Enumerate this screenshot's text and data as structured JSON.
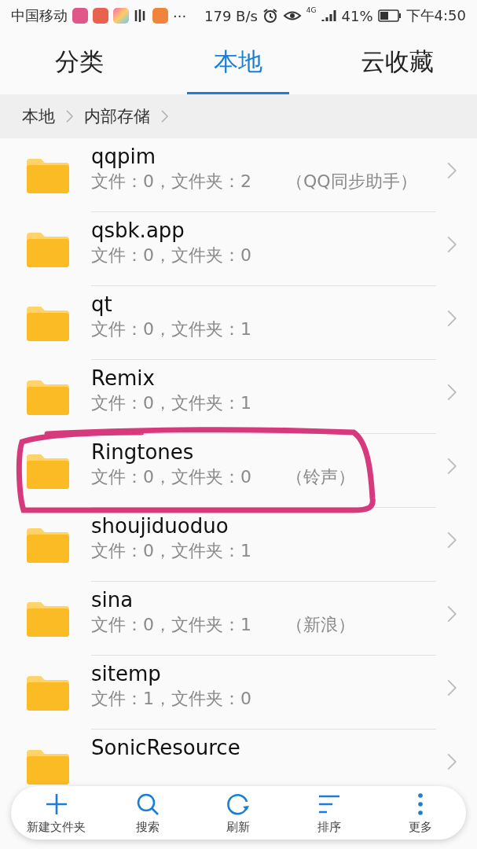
{
  "status_bar": {
    "carrier": "中国移动",
    "more": "···",
    "speed": "179 B/s",
    "network_type": "4G",
    "battery": "41%",
    "time": "下午4:50"
  },
  "tabs": [
    {
      "label": "分类",
      "selected": false
    },
    {
      "label": "本地",
      "selected": true
    },
    {
      "label": "云收藏",
      "selected": false
    }
  ],
  "breadcrumb": [
    "本地",
    "内部存储"
  ],
  "folders": [
    {
      "name": "qqpim",
      "info": "文件：0，文件夹：2",
      "note": "（QQ同步助手）"
    },
    {
      "name": "qsbk.app",
      "info": "文件：0，文件夹：0"
    },
    {
      "name": "qt",
      "info": "文件：0，文件夹：1"
    },
    {
      "name": "Remix",
      "info": "文件：0，文件夹：1"
    },
    {
      "name": "Ringtones",
      "info": "文件：0，文件夹：0",
      "note": "（铃声）"
    },
    {
      "name": "shoujiduoduo",
      "info": "文件：0，文件夹：1"
    },
    {
      "name": "sina",
      "info": "文件：0，文件夹：1",
      "note": "（新浪）"
    },
    {
      "name": "sitemp",
      "info": "文件：1，文件夹：0"
    },
    {
      "name": "SonicResource"
    }
  ],
  "toolbar": [
    {
      "kind": "new-folder",
      "label": "新建文件夹"
    },
    {
      "kind": "search",
      "label": "搜索"
    },
    {
      "kind": "refresh",
      "label": "刷新"
    },
    {
      "kind": "sort",
      "label": "排序"
    },
    {
      "kind": "more",
      "label": "更多"
    }
  ]
}
